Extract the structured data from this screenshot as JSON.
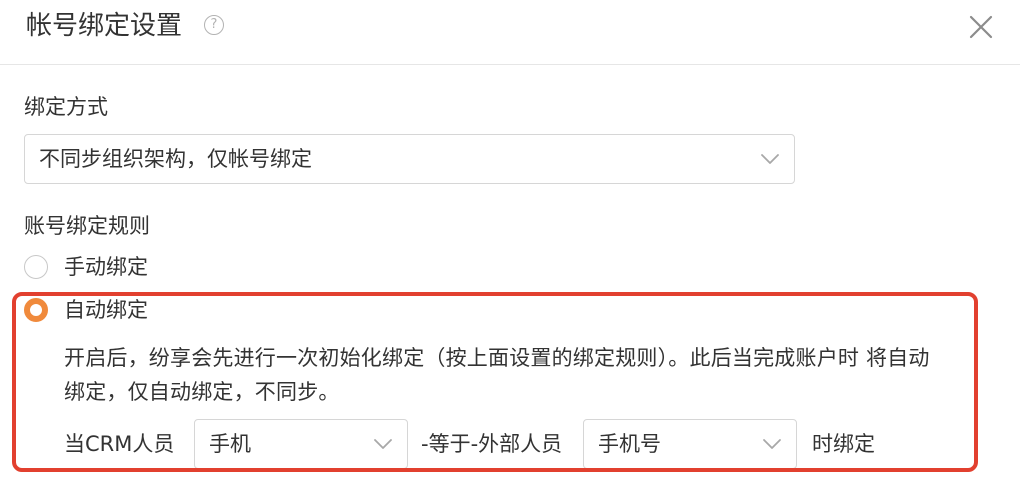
{
  "dialog": {
    "title": "帐号绑定设置",
    "help_icon": "question-circle-icon",
    "close_icon": "close-icon"
  },
  "binding_method": {
    "label": "绑定方式",
    "selected": "不同步组织架构，仅帐号绑定"
  },
  "binding_rule": {
    "label": "账号绑定规则",
    "options": [
      {
        "label": "手动绑定",
        "selected": false
      },
      {
        "label": "自动绑定",
        "selected": true
      }
    ],
    "auto_description_line1": "开启后，纷享会先进行一次初始化绑定（按上面设置的绑定规则）。此后当完成账户时 将自动",
    "auto_description_line2": "绑定，仅自动绑定，不同步。",
    "rule": {
      "prefix": "当CRM人员",
      "crm_field": "手机",
      "middle": "-等于-外部人员",
      "external_field": "手机号",
      "suffix": "时绑定"
    }
  },
  "colors": {
    "accent_orange": "#f08a3c",
    "highlight_red": "#e2402f",
    "text": "#333333",
    "border": "#d6d6d6"
  }
}
